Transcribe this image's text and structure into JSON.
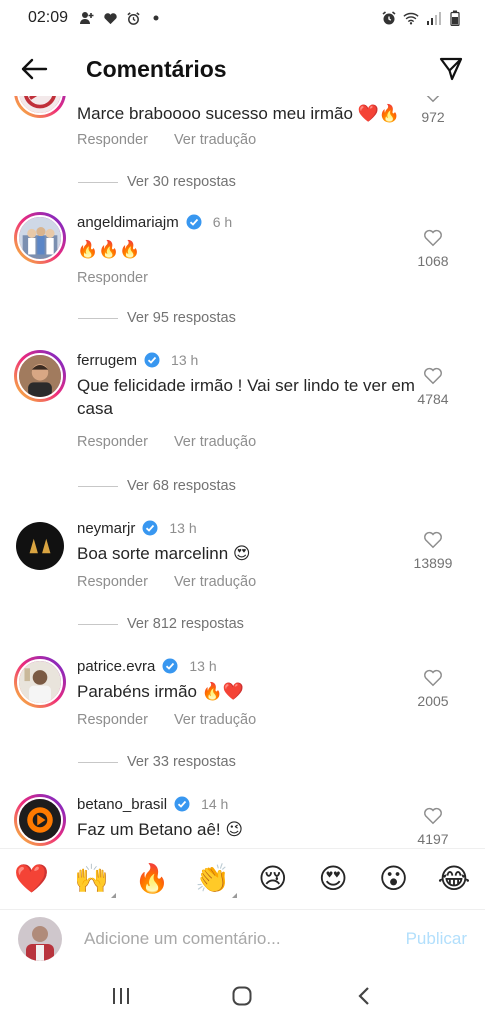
{
  "status_bar": {
    "time": "02:09"
  },
  "header": {
    "title": "Comentários"
  },
  "comments": [
    {
      "username": "",
      "time": "",
      "text": "Marce braboooo sucesso meu irmão ❤️🔥",
      "reply_label": "Responder",
      "translate_label": "Ver tradução",
      "likes": "972",
      "view_replies": "Ver 30 respostas"
    },
    {
      "username": "angeldimariajm",
      "time": "6 h",
      "text": "🔥🔥🔥",
      "reply_label": "Responder",
      "translate_label": "",
      "likes": "1068",
      "view_replies": "Ver 95 respostas"
    },
    {
      "username": "ferrugem",
      "time": "13 h",
      "text": "Que felicidade irmão ! Vai ser lindo te ver em casa",
      "reply_label": "Responder",
      "translate_label": "Ver tradução",
      "likes": "4784",
      "view_replies": "Ver 68 respostas"
    },
    {
      "username": "neymarjr",
      "time": "13 h",
      "text": "Boa sorte marcelinn 😍",
      "reply_label": "Responder",
      "translate_label": "Ver tradução",
      "likes": "13899",
      "view_replies": "Ver 812 respostas"
    },
    {
      "username": "patrice.evra",
      "time": "13 h",
      "text": "Parabéns irmão 🔥❤️",
      "reply_label": "Responder",
      "translate_label": "Ver tradução",
      "likes": "2005",
      "view_replies": "Ver 33 respostas"
    },
    {
      "username": "betano_brasil",
      "time": "14 h",
      "text": "Faz um Betano aê! 😉",
      "reply_label": "",
      "translate_label": "",
      "likes": "4197",
      "view_replies": ""
    }
  ],
  "emoji_bar": [
    "❤️",
    "🙌",
    "🔥",
    "👏",
    "😢",
    "😍",
    "😮",
    "😂"
  ],
  "comment_input": {
    "placeholder": "Adicione um comentário...",
    "post_label": "Publicar"
  },
  "colors": {
    "verified": "#3897f0",
    "post_disabled": "#b2dffc",
    "secondary_text": "#8e8e8e"
  }
}
